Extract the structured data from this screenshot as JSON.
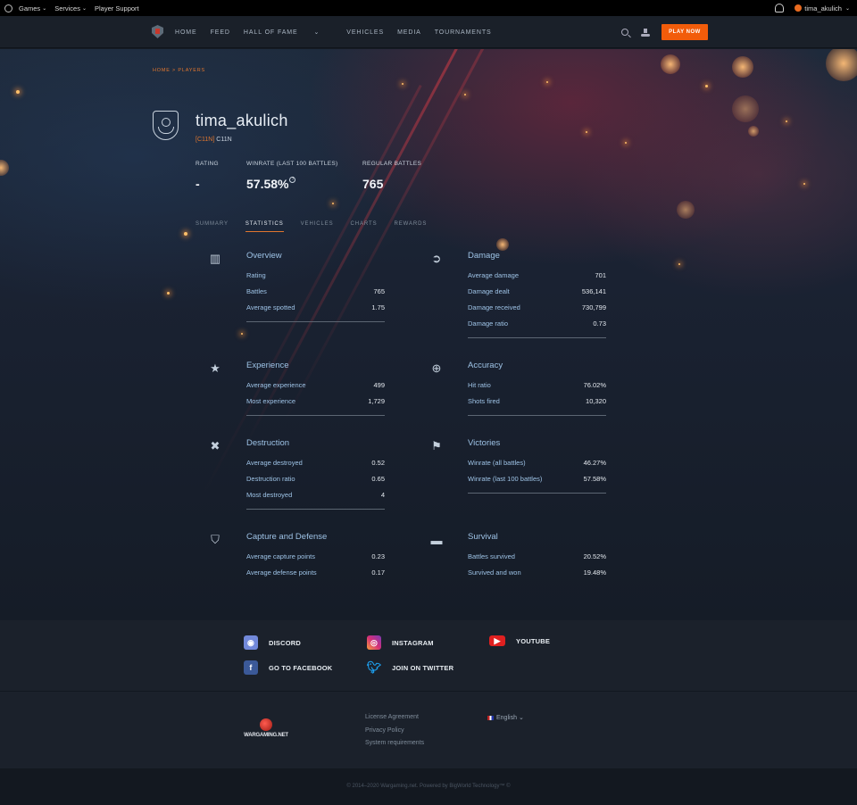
{
  "sysbar": {
    "games": "Games",
    "services": "Services",
    "support": "Player Support",
    "username": "tima_akulich"
  },
  "nav": {
    "home": "HOME",
    "feed": "FEED",
    "hall_of_fame": "HALL OF FAME",
    "vehicles": "VEHICLES",
    "media": "MEDIA",
    "tournaments": "TOURNAMENTS",
    "play_now": "PLAY NOW"
  },
  "breadcrumb": "HOME > PLAYERS",
  "player": {
    "name": "tima_akulich",
    "clan_tag": "[C11N]",
    "clan_name": "C11N"
  },
  "kpis": {
    "rating_label": "RATING",
    "rating_value": "-",
    "winrate_label": "WINRATE (LAST 100 BATTLES)",
    "winrate_value": "57.58%",
    "battles_label": "REGULAR BATTLES",
    "battles_value": "765"
  },
  "tabs": [
    "SUMMARY",
    "STATISTICS",
    "VEHICLES",
    "CHARTS",
    "REWARDS"
  ],
  "active_tab": "STATISTICS",
  "stats": {
    "overview": {
      "title": "Overview",
      "icon": "bar-chart-icon",
      "rows": [
        {
          "label": "Rating",
          "value": ""
        },
        {
          "label": "Battles",
          "value": "765"
        },
        {
          "label": "Average spotted",
          "value": "1.75"
        }
      ]
    },
    "damage": {
      "title": "Damage",
      "icon": "shell-icon",
      "rows": [
        {
          "label": "Average damage",
          "value": "701"
        },
        {
          "label": "Damage dealt",
          "value": "536,141"
        },
        {
          "label": "Damage received",
          "value": "730,799"
        },
        {
          "label": "Damage ratio",
          "value": "0.73"
        }
      ]
    },
    "experience": {
      "title": "Experience",
      "icon": "star-icon",
      "rows": [
        {
          "label": "Average experience",
          "value": "499"
        },
        {
          "label": "Most experience",
          "value": "1,729"
        }
      ]
    },
    "accuracy": {
      "title": "Accuracy",
      "icon": "crosshair-icon",
      "rows": [
        {
          "label": "Hit ratio",
          "value": "76.02%"
        },
        {
          "label": "Shots fired",
          "value": "10,320"
        }
      ]
    },
    "destruction": {
      "title": "Destruction",
      "icon": "destroyed-tank-icon",
      "rows": [
        {
          "label": "Average destroyed",
          "value": "0.52"
        },
        {
          "label": "Destruction ratio",
          "value": "0.65"
        },
        {
          "label": "Most destroyed",
          "value": "4"
        }
      ]
    },
    "victories": {
      "title": "Victories",
      "icon": "flag-icon",
      "rows": [
        {
          "label": "Winrate (all battles)",
          "value": "46.27%"
        },
        {
          "label": "Winrate (last 100 battles)",
          "value": "57.58%"
        }
      ]
    },
    "capture": {
      "title": "Capture and Defense",
      "icon": "shield-icon",
      "rows": [
        {
          "label": "Average capture points",
          "value": "0.23"
        },
        {
          "label": "Average defense points",
          "value": "0.17"
        }
      ]
    },
    "survival": {
      "title": "Survival",
      "icon": "tank-icon",
      "rows": [
        {
          "label": "Battles survived",
          "value": "20.52%"
        },
        {
          "label": "Survived and won",
          "value": "19.48%"
        }
      ]
    }
  },
  "social": {
    "discord": "DISCORD",
    "instagram": "INSTAGRAM",
    "youtube": "YOUTUBE",
    "facebook": "GO TO FACEBOOK",
    "twitter": "JOIN ON TWITTER"
  },
  "footer": {
    "logo_text": "WARGAMING.NET",
    "license": "License Agreement",
    "privacy": "Privacy Policy",
    "requirements": "System requirements",
    "language": "English",
    "copyright": "© 2014–2020 Wargaming.net. Powered by BigWorld Technology™ ©"
  },
  "colors": {
    "accent": "#e0762e",
    "play_button": "#f25c0a",
    "stat_label": "#9ec3e6",
    "discord": "#7289da",
    "youtube": "#e02020",
    "facebook": "#3b5998",
    "twitter": "#1da1f2"
  }
}
